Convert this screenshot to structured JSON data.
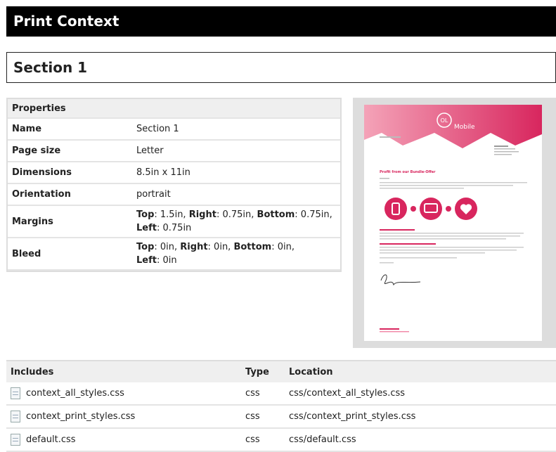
{
  "title": "Print Context",
  "section": "Section 1",
  "properties": {
    "header": "Properties",
    "rows": [
      {
        "key": "Name",
        "value": "Section 1"
      },
      {
        "key": "Page size",
        "value": "Letter"
      },
      {
        "key": "Dimensions",
        "value": "8.5in x 11in"
      },
      {
        "key": "Orientation",
        "value": "portrait"
      }
    ],
    "margins": {
      "key": "Margins",
      "top_label": "Top",
      "top": ": 1.5in, ",
      "right_label": "Right",
      "right": ": 0.75in, ",
      "bottom_label": "Bottom",
      "bottom": ": 0.75in,",
      "left_label": "Left",
      "left": ": 0.75in"
    },
    "bleed": {
      "key": "Bleed",
      "top_label": "Top",
      "top": ": 0in, ",
      "right_label": "Right",
      "right": ": 0in, ",
      "bottom_label": "Bottom",
      "bottom": ": 0in,",
      "left_label": "Left",
      "left": ": 0in"
    }
  },
  "preview": {
    "logo_ol": "OL",
    "logo_text": "Mobile",
    "headline": "Profit from our Bundle-Offer",
    "accent_color": "#d8265e",
    "accent_light": "#f28aa8"
  },
  "includes": {
    "columns": {
      "name": "Includes",
      "type": "Type",
      "location": "Location"
    },
    "rows": [
      {
        "name": "context_all_styles.css",
        "type": "css",
        "location": "css/context_all_styles.css"
      },
      {
        "name": "context_print_styles.css",
        "type": "css",
        "location": "css/context_print_styles.css"
      },
      {
        "name": "default.css",
        "type": "css",
        "location": "css/default.css"
      }
    ]
  }
}
